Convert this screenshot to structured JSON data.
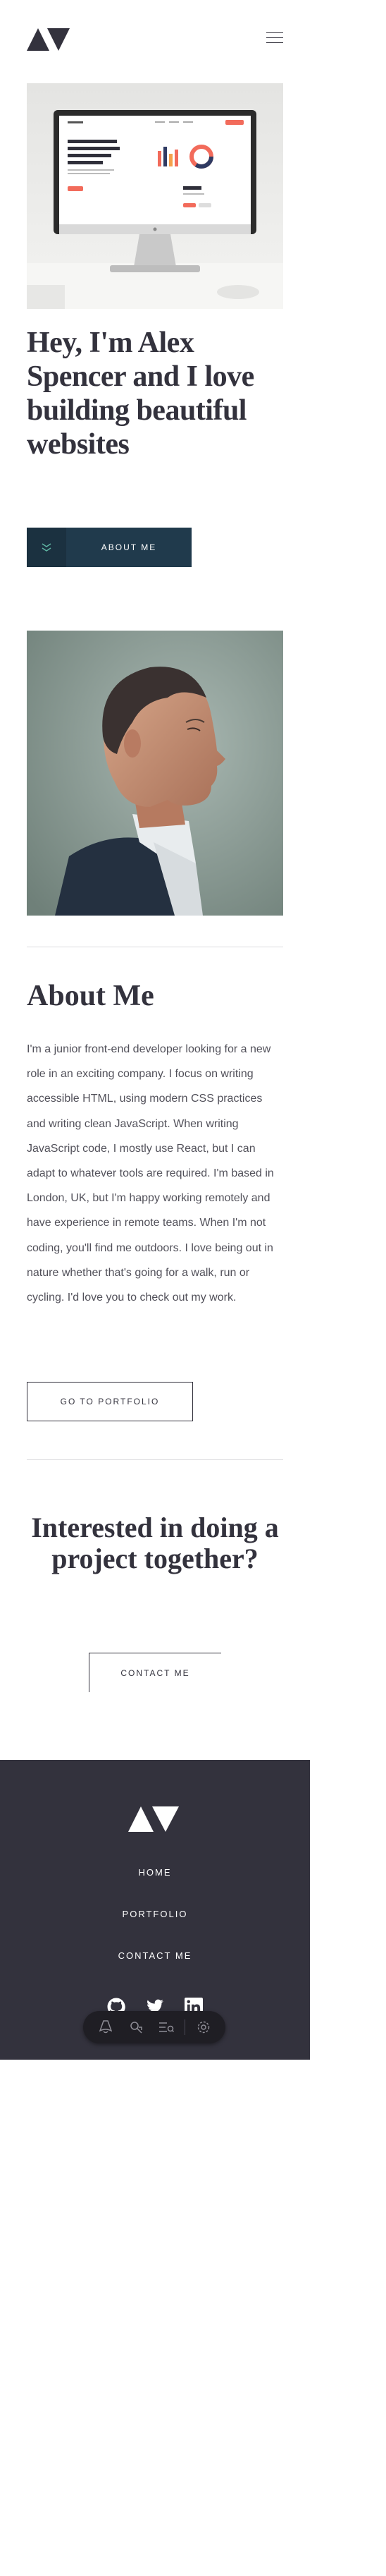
{
  "header": {
    "logo_icon": "triangles-logo-icon",
    "menu_icon": "hamburger-menu-icon"
  },
  "hero": {
    "image_icon": "monitor-mockup-image",
    "title": "Hey, I'm Alex Spencer and I love building beautiful websites",
    "button_label": "ABOUT ME",
    "button_icon": "chevrons-down-icon"
  },
  "about": {
    "image": "profile-photo",
    "title": "About Me",
    "body": "I'm a junior front-end developer looking for a new role in an exciting company. I focus on writing accessible HTML, using modern CSS practices and writing clean JavaScript. When writing JavaScript code, I mostly use React, but I can adapt to whatever tools are required. I'm based in London, UK, but I'm happy working remotely and have experience in remote teams. When I'm not coding, you'll find me outdoors. I love being out in nature whether that's going for a walk, run or cycling. I'd love you to check out my work.",
    "button_label": "GO TO PORTFOLIO"
  },
  "cta": {
    "title": "Interested in doing a project together?",
    "button_label": "CONTACT ME"
  },
  "footer": {
    "links": [
      "HOME",
      "PORTFOLIO",
      "CONTACT ME"
    ],
    "social_icons": [
      "github-icon",
      "twitter-icon",
      "linkedin-icon"
    ]
  },
  "devtools_bar": {
    "icons": [
      "astro-icon",
      "inspect-icon",
      "audit-icon",
      "settings-icon"
    ]
  },
  "colors": {
    "primary": "#33323d",
    "accent": "#203a4c",
    "footer_bg": "#33323d",
    "divider": "#dcdcdf"
  }
}
